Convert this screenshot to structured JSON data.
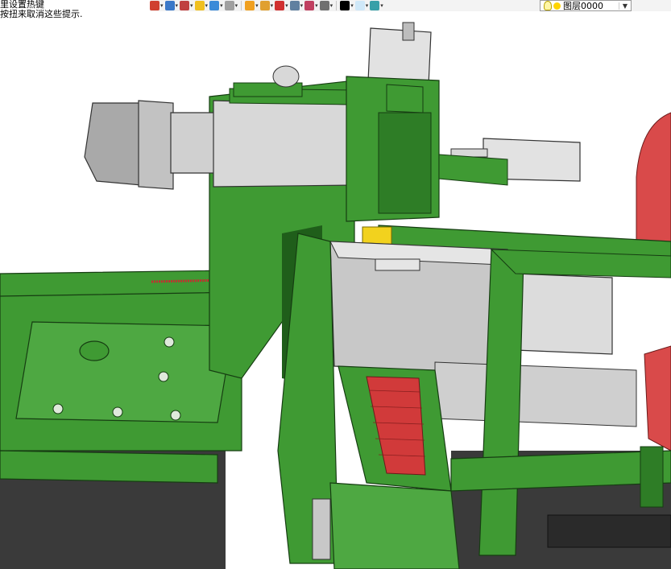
{
  "hint": {
    "line1": "里设置热键",
    "line2": "按扭来取消这些提示."
  },
  "toolbar": {
    "buttons": [
      {
        "icon": "undo-icon",
        "color": "#d04030"
      },
      {
        "icon": "layers-icon",
        "color": "#3a78c8"
      },
      {
        "icon": "pencil-icon",
        "color": "#c04040"
      },
      {
        "icon": "box-yellow-icon",
        "color": "#f0c020"
      },
      {
        "icon": "box-blue-icon",
        "color": "#3a8ad8"
      },
      {
        "icon": "cube-outline-icon",
        "color": "#a0a0a0"
      },
      {
        "icon": "render-style-icon",
        "color": "#f0a020"
      },
      {
        "icon": "zoom-fit-icon",
        "color": "#e0a030"
      },
      {
        "icon": "move-icon",
        "color": "#d03030"
      },
      {
        "icon": "page-icon",
        "color": "#6080a0"
      },
      {
        "icon": "frame-icon",
        "color": "#c04060"
      },
      {
        "icon": "camera-icon",
        "color": "#707070"
      },
      {
        "icon": "black-swatch-icon",
        "color": "#000000"
      },
      {
        "icon": "light-blue-swatch-icon",
        "color": "#cfe8f8"
      },
      {
        "icon": "stack-icon",
        "color": "#38a0a8"
      }
    ],
    "layer": {
      "name": "图层0000"
    }
  },
  "colors": {
    "green_light": "#3f9a33",
    "green_dark": "#1f5e1a",
    "grey_light": "#d8d8d8",
    "grey_mid": "#9a9a9a",
    "red": "#d94a4a",
    "dark_floor": "#3a3a3a"
  }
}
